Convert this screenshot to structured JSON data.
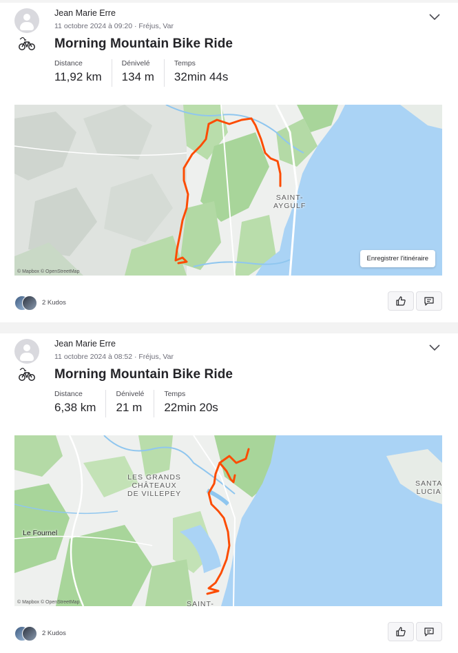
{
  "activities": [
    {
      "athlete_name": "Jean Marie Erre",
      "meta": "11 octobre 2024 à 09:20 · Fréjus, Var",
      "title": "Morning Mountain Bike Ride",
      "sport_icon": "mountain-bike-icon",
      "stats": [
        {
          "label": "Distance",
          "value": "11,92 km"
        },
        {
          "label": "Dénivelé",
          "value": "134 m"
        },
        {
          "label": "Temps",
          "value": "32min 44s"
        }
      ],
      "map": {
        "place_label": "SAINT-\nAYGULF",
        "save_route_label": "Enregistrer l'itinéraire",
        "attribution": "© Mapbox © OpenStreetMap",
        "route_color": "#fc4c02"
      },
      "kudos": "2 Kudos"
    },
    {
      "athlete_name": "Jean Marie Erre",
      "meta": "11 octobre 2024 à 08:52 · Fréjus, Var",
      "title": "Morning Mountain Bike Ride",
      "sport_icon": "mountain-bike-icon",
      "stats": [
        {
          "label": "Distance",
          "value": "6,38 km"
        },
        {
          "label": "Dénivelé",
          "value": "21 m"
        },
        {
          "label": "Temps",
          "value": "22min 20s"
        }
      ],
      "map": {
        "place_label_1": "LES GRANDS\nCHÂTEAUX\nDE VILLEPEY",
        "place_label_2": "Le Fournel",
        "place_label_3": "SANTA\nLUCIA",
        "place_label_4": "SAINT-",
        "attribution": "© Mapbox © OpenStreetMap",
        "route_color": "#fc4c02"
      },
      "kudos": "2 Kudos"
    }
  ],
  "colors": {
    "accent": "#fc4c02",
    "water": "#aad3f5",
    "land": "#f2f2f0",
    "forest": "#a8d59a"
  }
}
